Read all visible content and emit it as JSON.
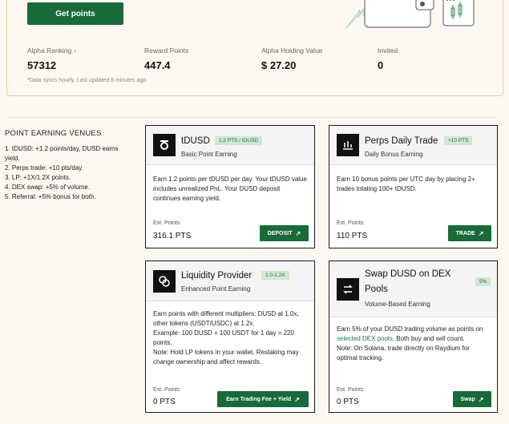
{
  "header": {
    "get_points_label": "Get points",
    "stats": [
      {
        "label": "Alpha Ranking",
        "value": "57312",
        "has_chevron": true
      },
      {
        "label": "Reward Points",
        "value": "447.4"
      },
      {
        "label": "Alpha Holding Value",
        "value": "$ 27.20"
      },
      {
        "label": "Invited",
        "value": "0"
      }
    ],
    "sync_note": "*Data syncs hourly. Last updated 8 minutes ago"
  },
  "venues": {
    "title": "POINT EARNING VENUES",
    "items": [
      "1. tDUSD: +1.2 points/day, DUSD earns yield.",
      "2. Perps trade: +10 pts/day.",
      "3. LP: +1X/1.2X points.",
      "4. DEX swap: +5% of volume.",
      "5. Referral: +5% bonus for both."
    ]
  },
  "cards": {
    "tdusd": {
      "icon": "tdusd-logo-icon",
      "title": "tDUSD",
      "badge": "1.2 PTS / tDUSD",
      "subtitle": "Basic Point Earning",
      "desc": "Earn 1.2 points per tDUSD per day. Your tDUSD value includes unrealized PnL. Your DUSD deposit continues earning yield.",
      "est_label": "Est. Points",
      "est_value": "316.1 PTS",
      "action": "DEPOSIT"
    },
    "perps": {
      "icon": "perps-chart-icon",
      "title": "Perps Daily Trade",
      "badge": "+10 PTS",
      "subtitle": "Daily Bonus Earning",
      "desc": "Earn 10 bonus points per UTC day by placing 2+ trades totaling 100+ tDUSD.",
      "est_label": "Est. Points",
      "est_value": "110 PTS",
      "action": "TRADE"
    },
    "lp": {
      "icon": "liquidity-coins-icon",
      "title": "Liquidity Provider",
      "badge": "1.0-1.2X",
      "subtitle": "Enhanced Point Earning",
      "desc_lines": [
        "Earn points with different multipliers: DUSD at 1.0x, other tokens (USDT/USDC) at 1.2x.",
        "Example: 100 DUSD + 100 USDT for 1 day = 220 points.",
        "Note: Hold LP tokens in your wallet. Restaking may change ownership and affect rewards."
      ],
      "est_label": "Est. Points",
      "est_value": "0 PTS",
      "action": "Earn Trading Fee + Yield"
    },
    "swap": {
      "icon": "swap-arrows-icon",
      "title_line1": "Swap DUSD on DEX",
      "title_line2": "Pools",
      "badge": "5%",
      "subtitle": "Volume-Based Earning",
      "desc_pre": "Earn 5% of your DUSD trading volume as points on ",
      "desc_link": "selected DEX pools",
      "desc_post": ". Both buy and sell count.",
      "desc_note": "Note: On Solana, trade directly on Raydium for optimal tracking.",
      "est_label": "Est. Points",
      "est_value": "0 PTS",
      "action": "Swap"
    }
  },
  "colors": {
    "primary_green": "#176b39",
    "badge_bg": "#cfe8d3",
    "card_border": "#1a1a1a",
    "top_card_border": "#f2c9a4"
  }
}
